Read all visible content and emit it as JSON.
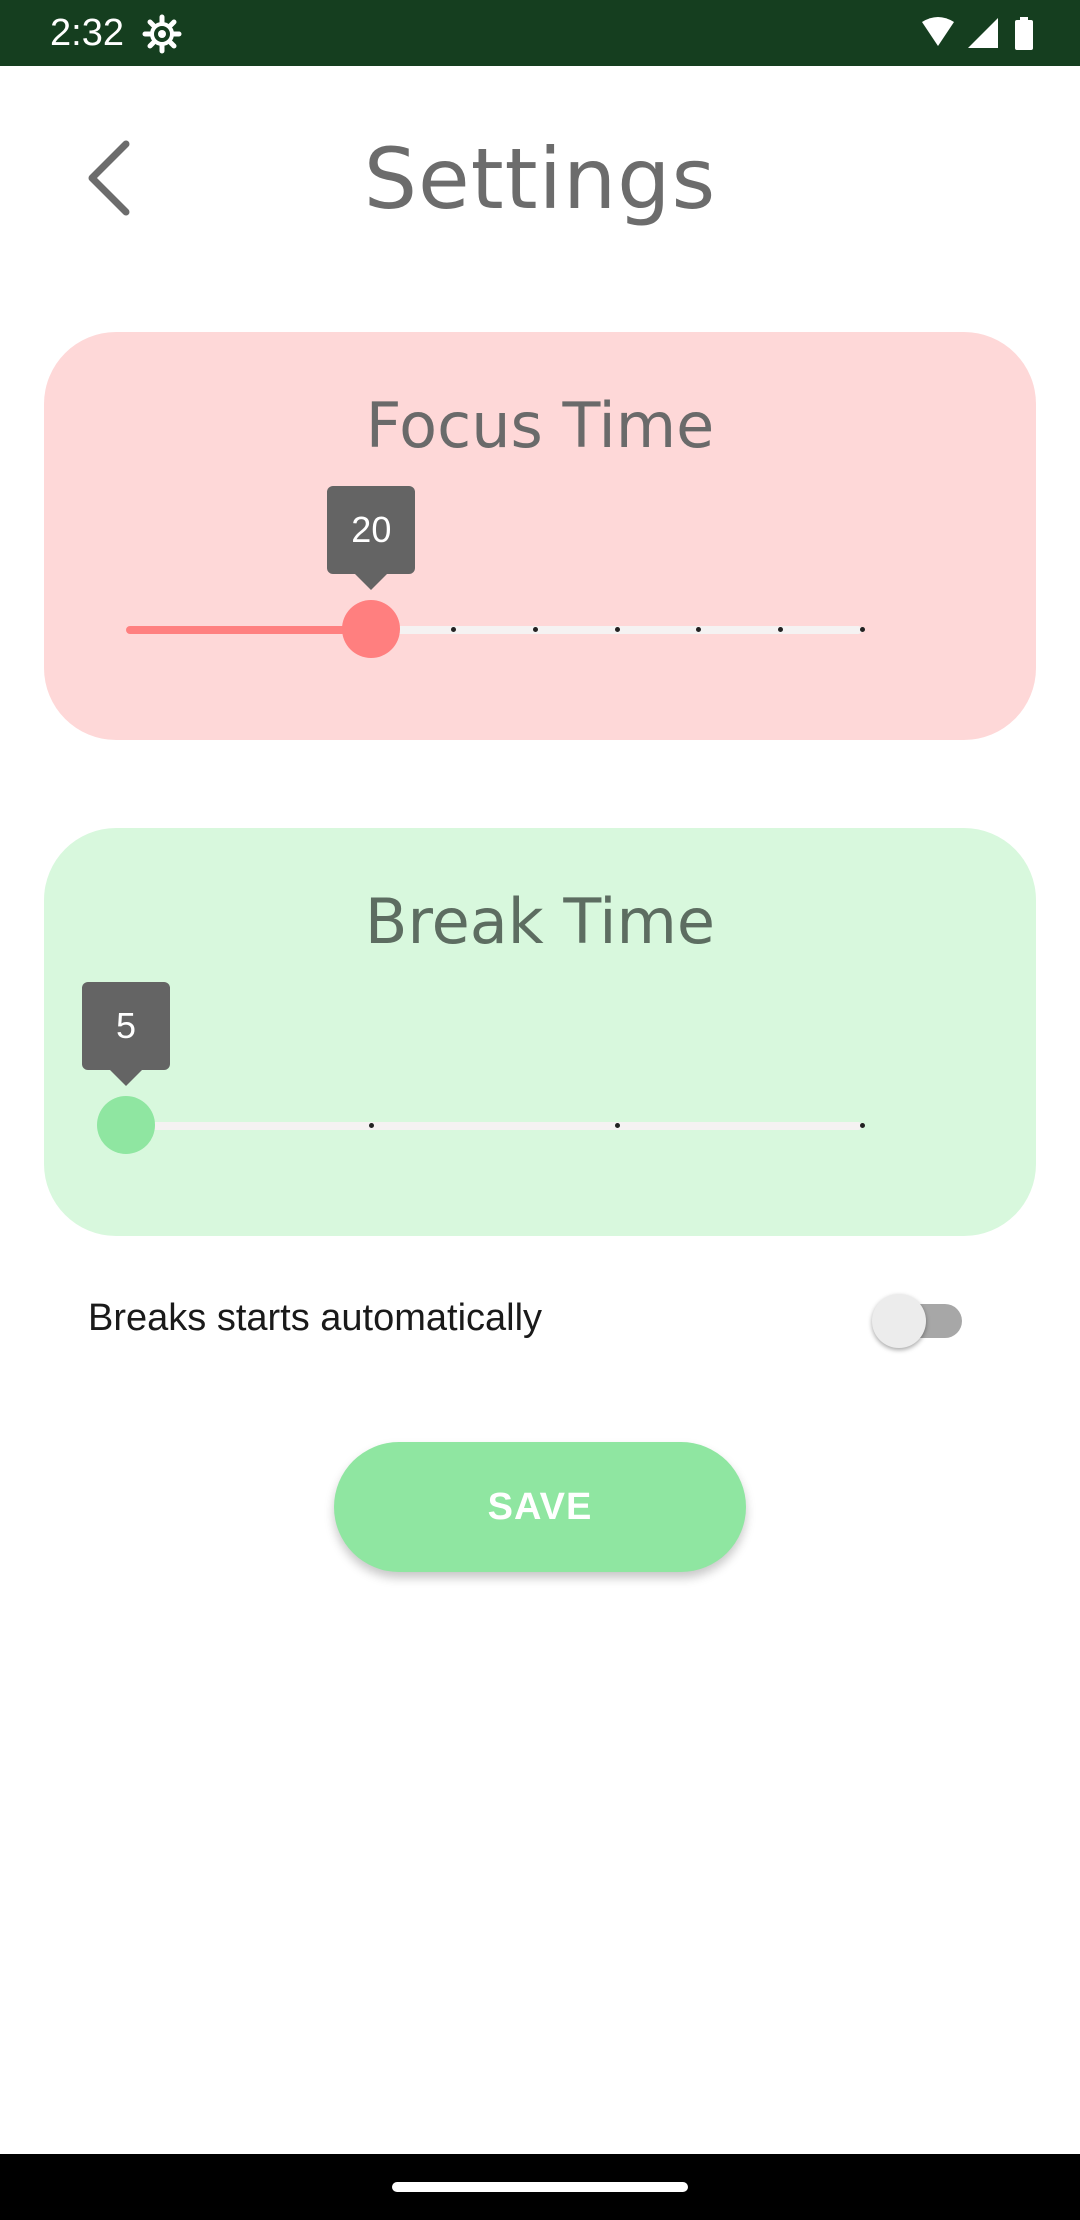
{
  "status_bar": {
    "time": "2:32",
    "icons": [
      "settings-gear-icon",
      "wifi-icon",
      "signal-icon",
      "battery-icon"
    ],
    "color": "#153e1f"
  },
  "header": {
    "title": "Settings",
    "back_icon": "chevron-left-icon"
  },
  "focus_card": {
    "title": "Focus Time",
    "slider": {
      "value": 20,
      "value_label": "20",
      "min": 5,
      "max": 50,
      "step": 5,
      "ticks": 10
    },
    "colors": {
      "card": "#fed8d8",
      "accent": "#ff7f7f"
    }
  },
  "break_card": {
    "title": "Break Time",
    "slider": {
      "value": 5,
      "value_label": "5",
      "min": 5,
      "max": 20,
      "step": 5,
      "ticks": 4
    },
    "colors": {
      "card": "#d8f8dd",
      "accent": "#8fe6a1"
    }
  },
  "auto_break": {
    "label": "Breaks starts automatically",
    "enabled": false
  },
  "save": {
    "label": "SAVE",
    "color": "#8fe6a1"
  }
}
